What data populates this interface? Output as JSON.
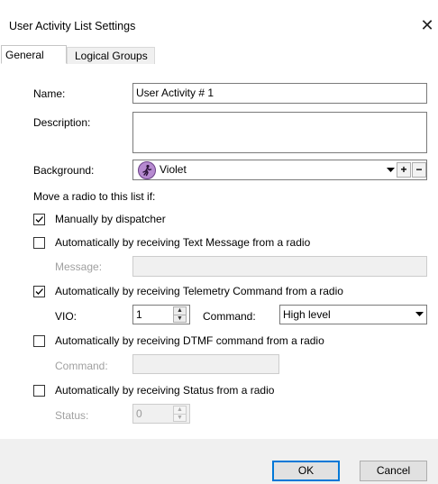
{
  "window": {
    "title": "User Activity List Settings",
    "close_glyph": "✕"
  },
  "tabs": [
    {
      "label": "General",
      "active": true
    },
    {
      "label": "Logical Groups",
      "active": false
    }
  ],
  "general": {
    "name_label": "Name:",
    "name_value": "User Activity # 1",
    "description_label": "Description:",
    "description_value": "",
    "background_label": "Background:",
    "background_value": "Violet",
    "background_icon": "running-person-icon",
    "background_color": "#b68ad0",
    "plus_label": "+",
    "minus_label": "−",
    "move_label": "Move a radio to this list if:",
    "options": [
      {
        "label": "Manually by dispatcher",
        "checked": true
      },
      {
        "label": "Automatically by receiving Text Message from a radio",
        "checked": false
      },
      {
        "label": "Automatically by receiving Telemetry Command from a radio",
        "checked": true
      },
      {
        "label": "Automatically by receiving DTMF command from a radio",
        "checked": false
      },
      {
        "label": "Automatically by receiving Status from a radio",
        "checked": false
      }
    ],
    "message_label": "Message:",
    "message_value": "",
    "vio_label": "VIO:",
    "vio_value": "1",
    "telemetry_command_label": "Command:",
    "telemetry_command_value": "High level",
    "dtmf_command_label": "Command:",
    "dtmf_command_value": "",
    "status_label": "Status:",
    "status_value": "0"
  },
  "footer": {
    "ok_label": "OK",
    "cancel_label": "Cancel"
  }
}
